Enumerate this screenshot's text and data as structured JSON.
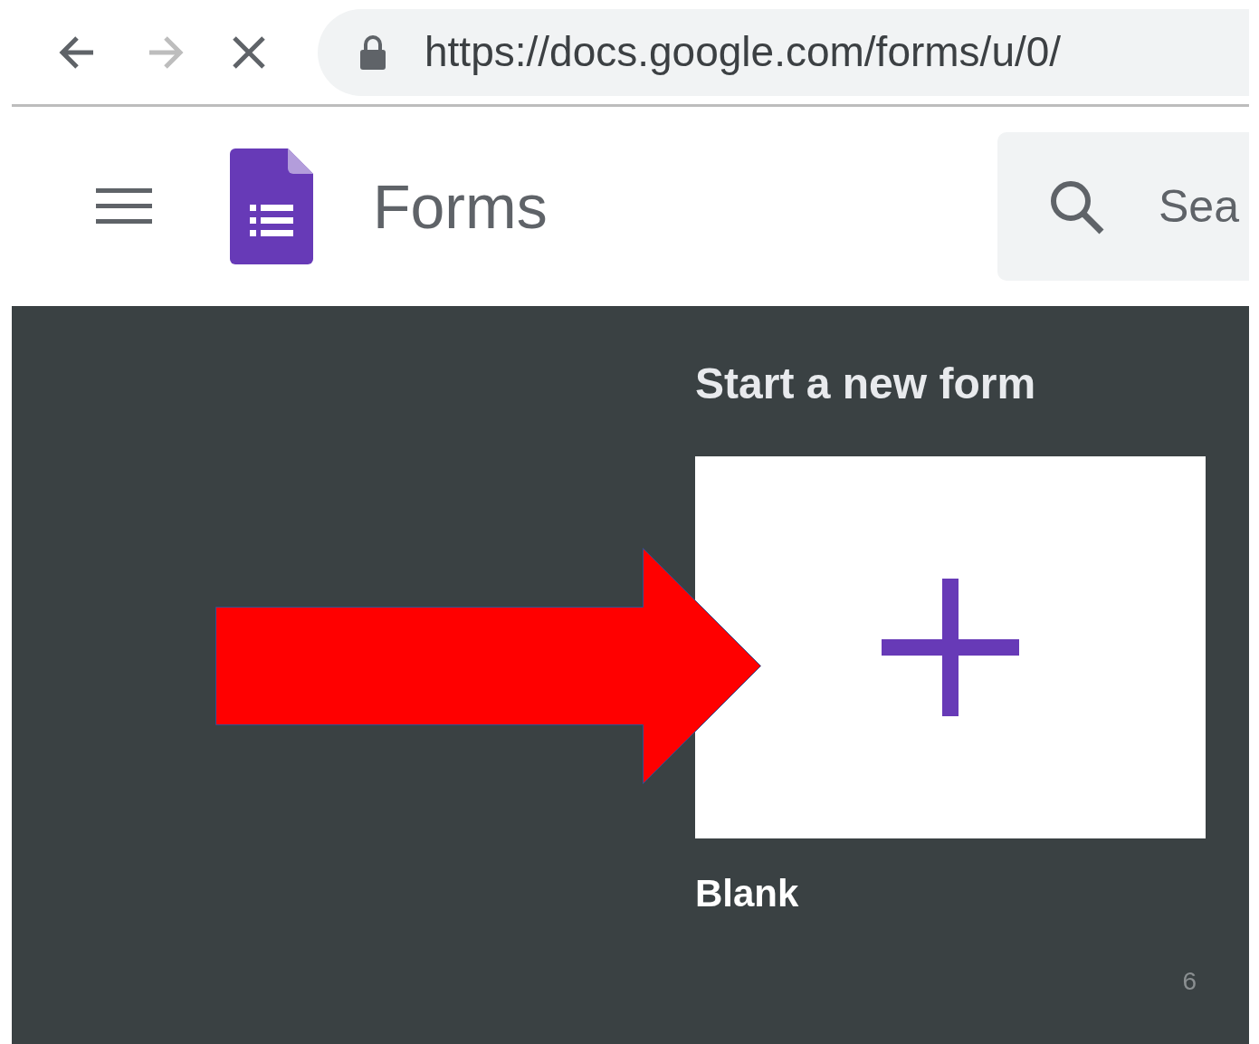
{
  "browser": {
    "nav_buttons": [
      {
        "kind": "back",
        "disabled": false
      },
      {
        "kind": "forward",
        "disabled": true
      },
      {
        "kind": "stop",
        "disabled": false
      }
    ],
    "url": "https://docs.google.com/forms/u/0/"
  },
  "header": {
    "app_name": "Forms",
    "search": {
      "placeholder": "Sea"
    }
  },
  "start_section": {
    "title": "Start a new form",
    "templates": [
      {
        "label": "Blank"
      }
    ]
  },
  "slide_number": "6"
}
